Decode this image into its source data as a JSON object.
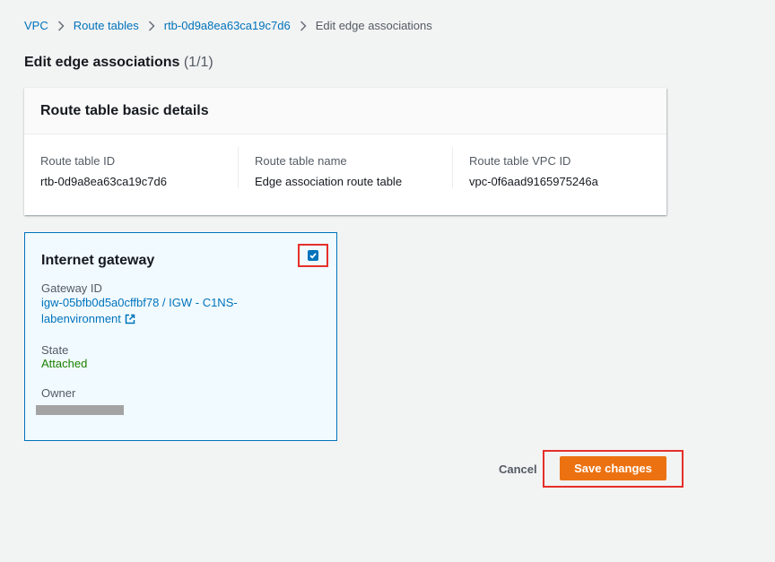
{
  "breadcrumb": {
    "items": [
      "VPC",
      "Route tables",
      "rtb-0d9a8ea63ca19c7d6"
    ],
    "current": "Edit edge associations"
  },
  "page": {
    "title": "Edit edge associations",
    "count": "(1/1)"
  },
  "details": {
    "header": "Route table basic details",
    "fields": [
      {
        "label": "Route table ID",
        "value": "rtb-0d9a8ea63ca19c7d6"
      },
      {
        "label": "Route table name",
        "value": "Edge association route table"
      },
      {
        "label": "Route table VPC ID",
        "value": "vpc-0f6aad9165975246a"
      }
    ]
  },
  "gateway_card": {
    "title": "Internet gateway",
    "checked": true,
    "gateway_id_label": "Gateway ID",
    "gateway_id_line1": "igw-05bfb0d5a0cffbf78 / IGW - C1NS-",
    "gateway_id_line2": "labenvironment",
    "state_label": "State",
    "state_value": "Attached",
    "owner_label": "Owner"
  },
  "actions": {
    "cancel_label": "Cancel",
    "save_label": "Save changes"
  },
  "colors": {
    "link": "#0073bb",
    "primary_button": "#ec7211",
    "success": "#1d8102",
    "highlight": "#e5302b"
  }
}
